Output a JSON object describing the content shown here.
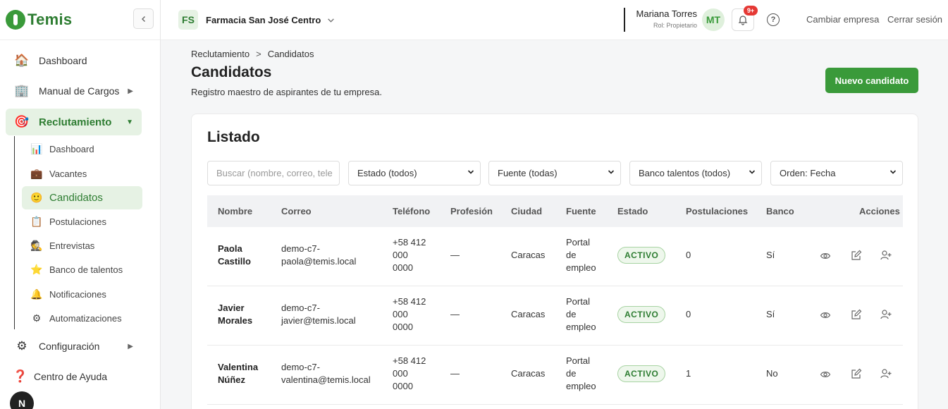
{
  "brand": {
    "name": "Temis",
    "accent": "#3a9a3a"
  },
  "sidebar": {
    "collapse_icon": "chevron-left",
    "items": [
      {
        "label": "Dashboard",
        "icon": "🏠"
      },
      {
        "label": "Manual de Cargos",
        "icon": "🏢"
      },
      {
        "label": "Reclutamiento",
        "icon": "🎯"
      },
      {
        "label": "Configuración",
        "icon": "⚙"
      },
      {
        "label": "Centro de Ayuda",
        "icon": "❓"
      }
    ],
    "sub_items": [
      {
        "label": "Dashboard",
        "icon": "📊"
      },
      {
        "label": "Vacantes",
        "icon": "💼"
      },
      {
        "label": "Candidatos",
        "icon": "🙂"
      },
      {
        "label": "Postulaciones",
        "icon": "📋"
      },
      {
        "label": "Entrevistas",
        "icon": "🕵"
      },
      {
        "label": "Banco de talentos",
        "icon": "⭐"
      },
      {
        "label": "Notificaciones",
        "icon": "🔔"
      },
      {
        "label": "Automatizaciones",
        "icon": "⚙"
      }
    ],
    "bottom_badge": "N"
  },
  "topbar": {
    "company_initials": "FS",
    "company_name": "Farmacia San José Centro",
    "user_name": "Mariana Torres",
    "user_role": "Rol: Propietario",
    "avatar_initials": "MT",
    "notif_count": "9+",
    "change_company": "Cambiar empresa",
    "logout": "Cerrar sesión"
  },
  "page": {
    "breadcrumb": [
      "Reclutamiento",
      "Candidatos"
    ],
    "breadcrumb_sep": ">",
    "title": "Candidatos",
    "subtitle": "Registro maestro de aspirantes de tu empresa.",
    "new_button": "Nuevo candidato"
  },
  "listado": {
    "title": "Listado",
    "search_placeholder": "Buscar (nombre, correo, tele",
    "filters": [
      "Estado (todos)",
      "Fuente (todas)",
      "Banco talentos (todos)",
      "Orden: Fecha"
    ],
    "columns": [
      "Nombre",
      "Correo",
      "Teléfono",
      "Profesión",
      "Ciudad",
      "Fuente",
      "Estado",
      "Postulaciones",
      "Banco",
      "Acciones"
    ],
    "rows": [
      {
        "name": [
          "Paola",
          "Castillo"
        ],
        "email": [
          "demo-c7-",
          "paola@temis.local"
        ],
        "phone": [
          "+58 412",
          "000",
          "0000"
        ],
        "profession": "—",
        "city": "Caracas",
        "source": [
          "Portal",
          "de",
          "empleo"
        ],
        "status": "ACTIVO",
        "applications": "0",
        "bank": "Sí"
      },
      {
        "name": [
          "Javier",
          "Morales"
        ],
        "email": [
          "demo-c7-",
          "javier@temis.local"
        ],
        "phone": [
          "+58 412",
          "000",
          "0000"
        ],
        "profession": "—",
        "city": "Caracas",
        "source": [
          "Portal",
          "de",
          "empleo"
        ],
        "status": "ACTIVO",
        "applications": "0",
        "bank": "Sí"
      },
      {
        "name": [
          "Valentina",
          "Núñez"
        ],
        "email": [
          "demo-c7-",
          "valentina@temis.local"
        ],
        "phone": [
          "+58 412",
          "000",
          "0000"
        ],
        "profession": "—",
        "city": "Caracas",
        "source": [
          "Portal",
          "de",
          "empleo"
        ],
        "status": "ACTIVO",
        "applications": "1",
        "bank": "No"
      }
    ]
  }
}
